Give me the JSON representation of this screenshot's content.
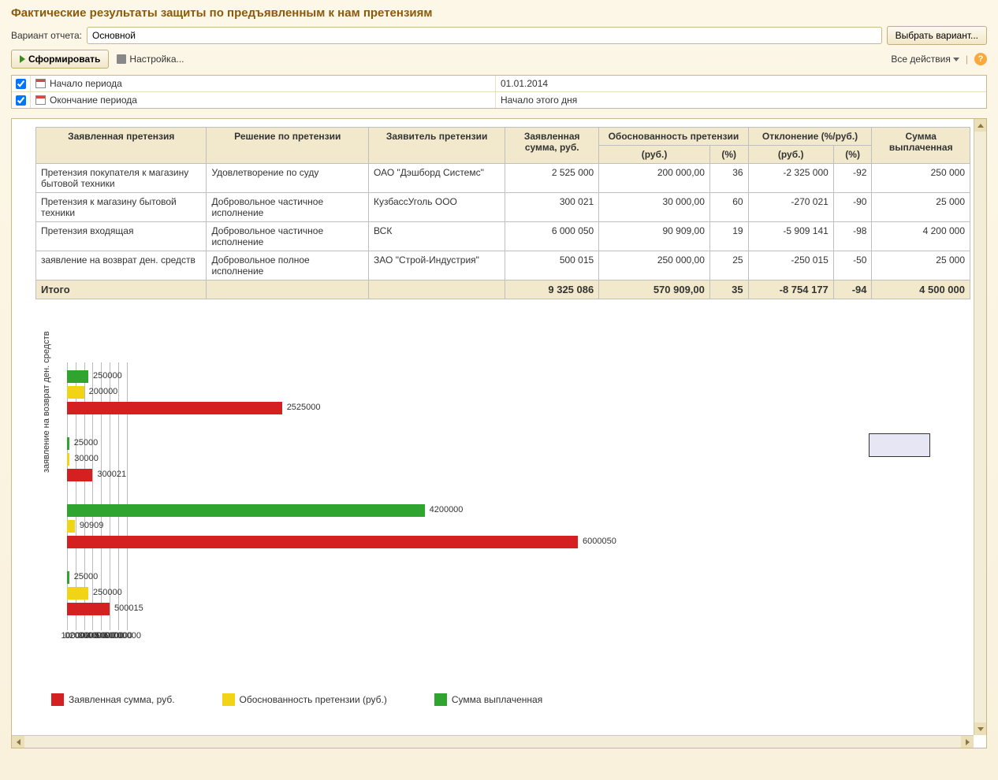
{
  "title": "Фактические результаты защиты по предъявленным  к нам претензиям",
  "variant_label": "Вариант отчета:",
  "variant_value": "Основной",
  "select_variant_btn": "Выбрать вариант...",
  "form_btn": "Сформировать",
  "settings_link": "Настройка...",
  "all_actions": "Все действия",
  "period": {
    "start_label": "Начало периода",
    "start_value": "01.01.2014",
    "end_label": "Окончание периода",
    "end_value": "Начало этого дня"
  },
  "table": {
    "headers": {
      "claim": "Заявленная претензия",
      "decision": "Решение по претензии",
      "claimant": "Заявитель претензии",
      "amount": "Заявленная сумма, руб.",
      "validity": "Обоснованность претензии",
      "deviation": "Отклонение (%/руб.)",
      "paid": "Сумма выплаченная",
      "rub": "(руб.)",
      "pct": "(%)"
    },
    "rows": [
      {
        "claim": "Претензия покупателя к магазину бытовой техники",
        "decision": "Удовлетворение по суду",
        "claimant": "ОАО \"Дэшборд Системс\"",
        "amount": "2 525 000",
        "v_rub": "200 000,00",
        "v_pct": "36",
        "d_rub": "-2 325 000",
        "d_pct": "-92",
        "paid": "250 000"
      },
      {
        "claim": "Претензия к магазину бытовой техники",
        "decision": "Добровольное частичное исполнение",
        "claimant": "КузбассУголь ООО",
        "amount": "300 021",
        "v_rub": "30 000,00",
        "v_pct": "60",
        "d_rub": "-270 021",
        "d_pct": "-90",
        "paid": "25 000"
      },
      {
        "claim": "Претензия входящая",
        "decision": "Добровольное частичное исполнение",
        "claimant": "ВСК",
        "amount": "6 000 050",
        "v_rub": "90 909,00",
        "v_pct": "19",
        "d_rub": "-5 909 141",
        "d_pct": "-98",
        "paid": "4 200 000"
      },
      {
        "claim": "заявление на возврат ден. средств",
        "decision": "Добровольное полное исполнение",
        "claimant": "ЗАО \"Строй-Индустрия\"",
        "amount": "500 015",
        "v_rub": "250 000,00",
        "v_pct": "25",
        "d_rub": "-250 015",
        "d_pct": "-50",
        "paid": "25 000"
      }
    ],
    "total": {
      "label": "Итого",
      "amount": "9 325 086",
      "v_rub": "570 909,00",
      "v_pct": "35",
      "d_rub": "-8 754 177",
      "d_pct": "-94",
      "paid": "4 500 000"
    }
  },
  "chart_data": {
    "type": "bar",
    "orientation": "horizontal",
    "x_ticks": [
      "0",
      "100000",
      "200000",
      "300000",
      "400000",
      "500000",
      "600000",
      "700000"
    ],
    "xlim": [
      0,
      700000
    ],
    "ylabel_visible": "заявление на возврат ден. средств",
    "series": [
      {
        "name": "Заявленная сумма, руб.",
        "color": "#d42020"
      },
      {
        "name": "Обоснованность претензии (руб.)",
        "color": "#f2d417"
      },
      {
        "name": "Сумма выплаченная",
        "color": "#2fa52f"
      }
    ],
    "categories": [
      "Претензия покупателя к магазину бытовой техники",
      "Претензия к магазину бытовой техники",
      "Претензия входящая",
      "заявление на возврат ден. средств"
    ],
    "groups": [
      {
        "green": 250000,
        "yellow": 200000,
        "red": 2525000
      },
      {
        "green": 25000,
        "yellow": 30000,
        "red": 300021
      },
      {
        "green": 4200000,
        "yellow": 90909,
        "red": 6000050
      },
      {
        "green": 25000,
        "yellow": 250000,
        "red": 500015
      }
    ],
    "bar_labels": {
      "g0": {
        "green": "250000",
        "yellow": "200000",
        "red": "2525000"
      },
      "g1": {
        "green": "25000",
        "yellow": "30000",
        "red": "300021"
      },
      "g2": {
        "green": "4200000",
        "yellow": "90909",
        "red": "6000050"
      },
      "g3": {
        "green": "25000",
        "yellow": "250000",
        "red": "500015"
      }
    }
  },
  "legend": {
    "red": "Заявленная сумма, руб.",
    "yellow": "Обоснованность претензии (руб.)",
    "green": "Сумма выплаченная"
  }
}
